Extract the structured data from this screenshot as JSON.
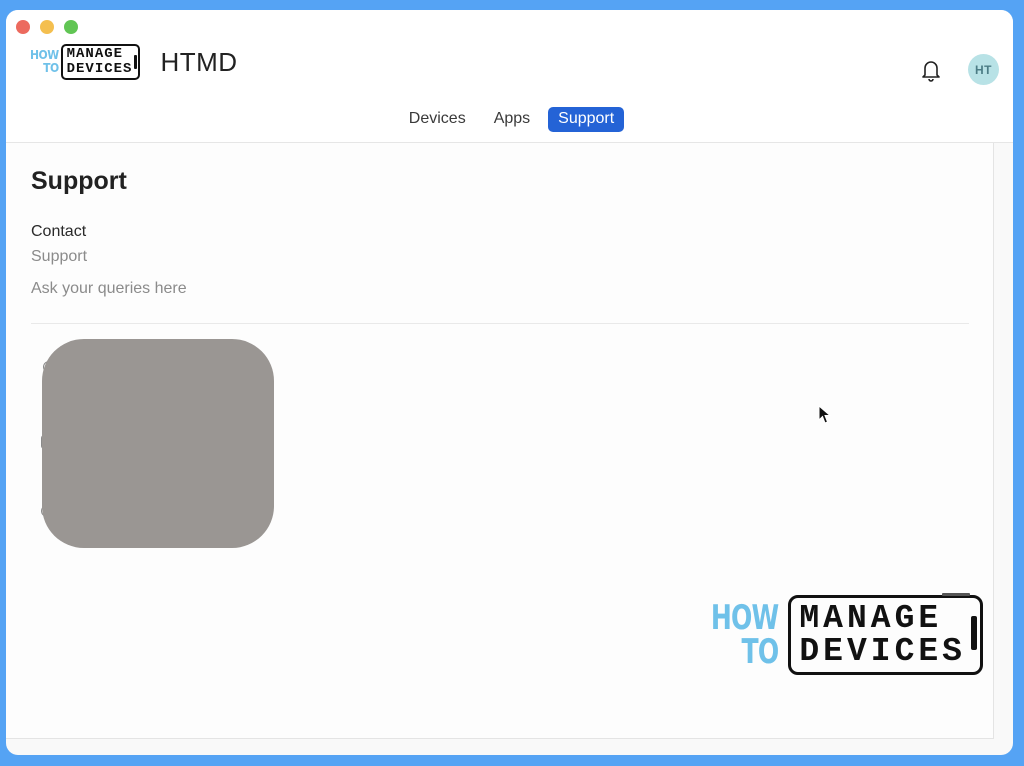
{
  "window": {
    "controls": [
      "close",
      "minimize",
      "maximize"
    ]
  },
  "header": {
    "logo": {
      "how": "HOW",
      "to": "TO",
      "line1": "MANAGE",
      "line2": "DEVICES"
    },
    "app_name": "HTMD",
    "notifications_icon": "bell-icon",
    "avatar_initials": "HT"
  },
  "tabs": [
    {
      "label": "Devices",
      "active": false
    },
    {
      "label": "Apps",
      "active": false
    },
    {
      "label": "Support",
      "active": true
    }
  ],
  "colors": {
    "accent": "#2463d6",
    "desktop_bg": "#55a3f4",
    "avatar_bg": "#b8e2e6",
    "logo_blue": "#6fc1e9"
  },
  "main": {
    "title": "Support",
    "contact": {
      "label": "Contact",
      "value": "Support",
      "description": "Ask your queries here"
    }
  },
  "watermark": {
    "how": "HOW",
    "to": "TO",
    "line1": "MANAGE",
    "line2": "DEVICES"
  }
}
